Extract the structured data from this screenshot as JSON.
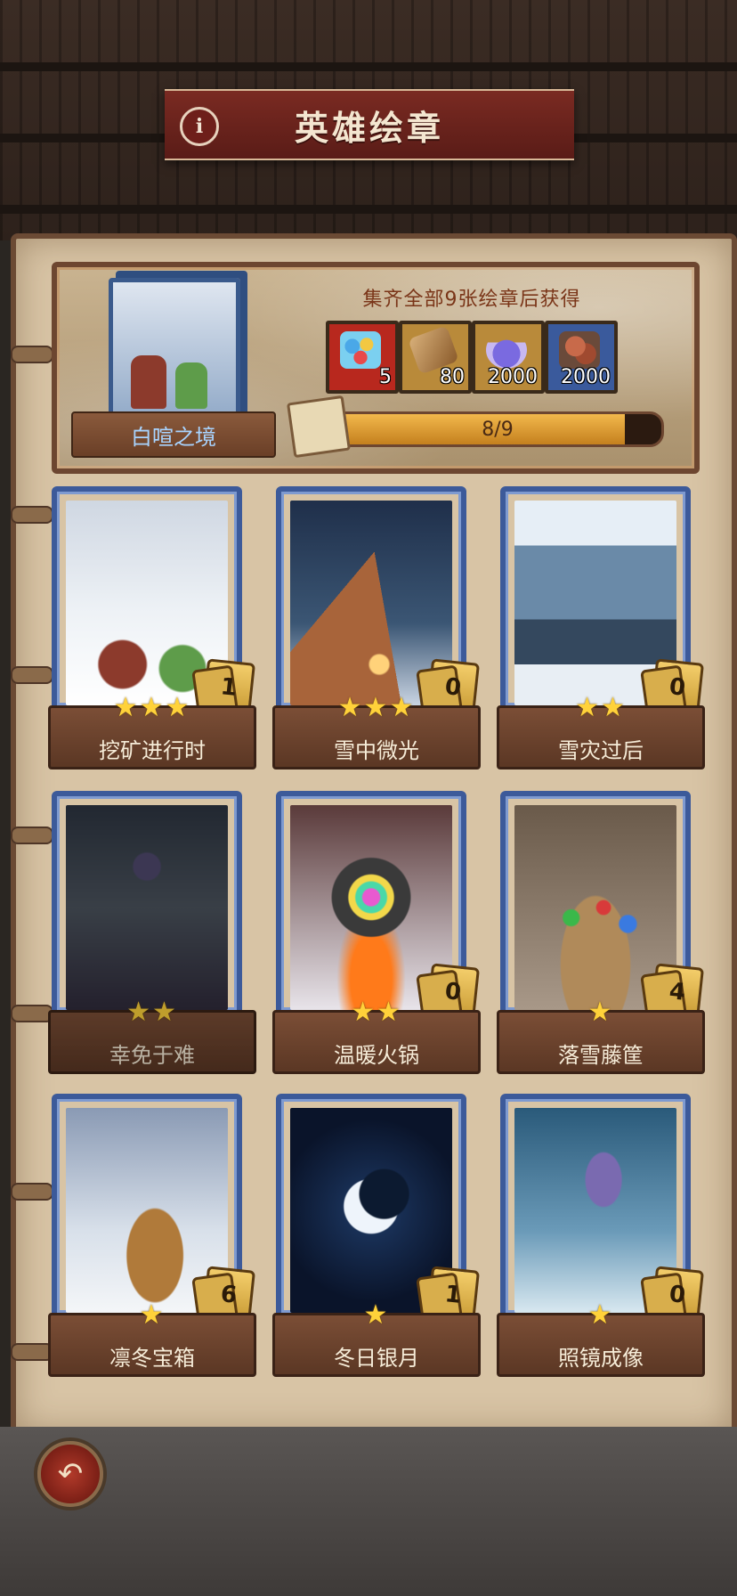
{
  "header": {
    "title": "英雄绘章",
    "info_icon": "i"
  },
  "collection": {
    "set_name": "白喧之境",
    "reward_caption": "集齐全部9张绘章后获得",
    "rewards": [
      {
        "icon": "gem-bag-icon",
        "qty": "5",
        "color": "#b8281e"
      },
      {
        "icon": "scroll-icon",
        "qty": "80",
        "color": "#b98a3a"
      },
      {
        "icon": "potion-icon",
        "qty": "2000",
        "color": "#b98a3a"
      },
      {
        "icon": "ore-icon",
        "qty": "2000",
        "color": "#3a5a9c"
      }
    ],
    "progress_text": "8/9",
    "progress": 0.889
  },
  "cards": [
    {
      "name": "挖矿进行时",
      "stars": "★★★",
      "count": "1",
      "locked": false,
      "art": "mining-goblins"
    },
    {
      "name": "雪中微光",
      "stars": "★★★",
      "count": "0",
      "locked": false,
      "art": "snow-tent"
    },
    {
      "name": "雪灾过后",
      "stars": "★★",
      "count": "0",
      "locked": false,
      "art": "snowed-house"
    },
    {
      "name": "幸免于难",
      "stars": "★★",
      "count": "",
      "locked": true,
      "art": "frozen-ruins"
    },
    {
      "name": "温暖火锅",
      "stars": "★★",
      "count": "0",
      "locked": false,
      "art": "cauldron-fire"
    },
    {
      "name": "落雪藤筐",
      "stars": "★",
      "count": "4",
      "locked": false,
      "art": "gem-basket"
    },
    {
      "name": "凛冬宝箱",
      "stars": "★",
      "count": "6",
      "locked": false,
      "art": "treasure-chest"
    },
    {
      "name": "冬日银月",
      "stars": "★",
      "count": "1",
      "locked": false,
      "art": "crescent-moon"
    },
    {
      "name": "照镜成像",
      "stars": "★",
      "count": "0",
      "locked": false,
      "art": "ice-mirror"
    }
  ],
  "footer": {
    "back_icon": "↶"
  }
}
